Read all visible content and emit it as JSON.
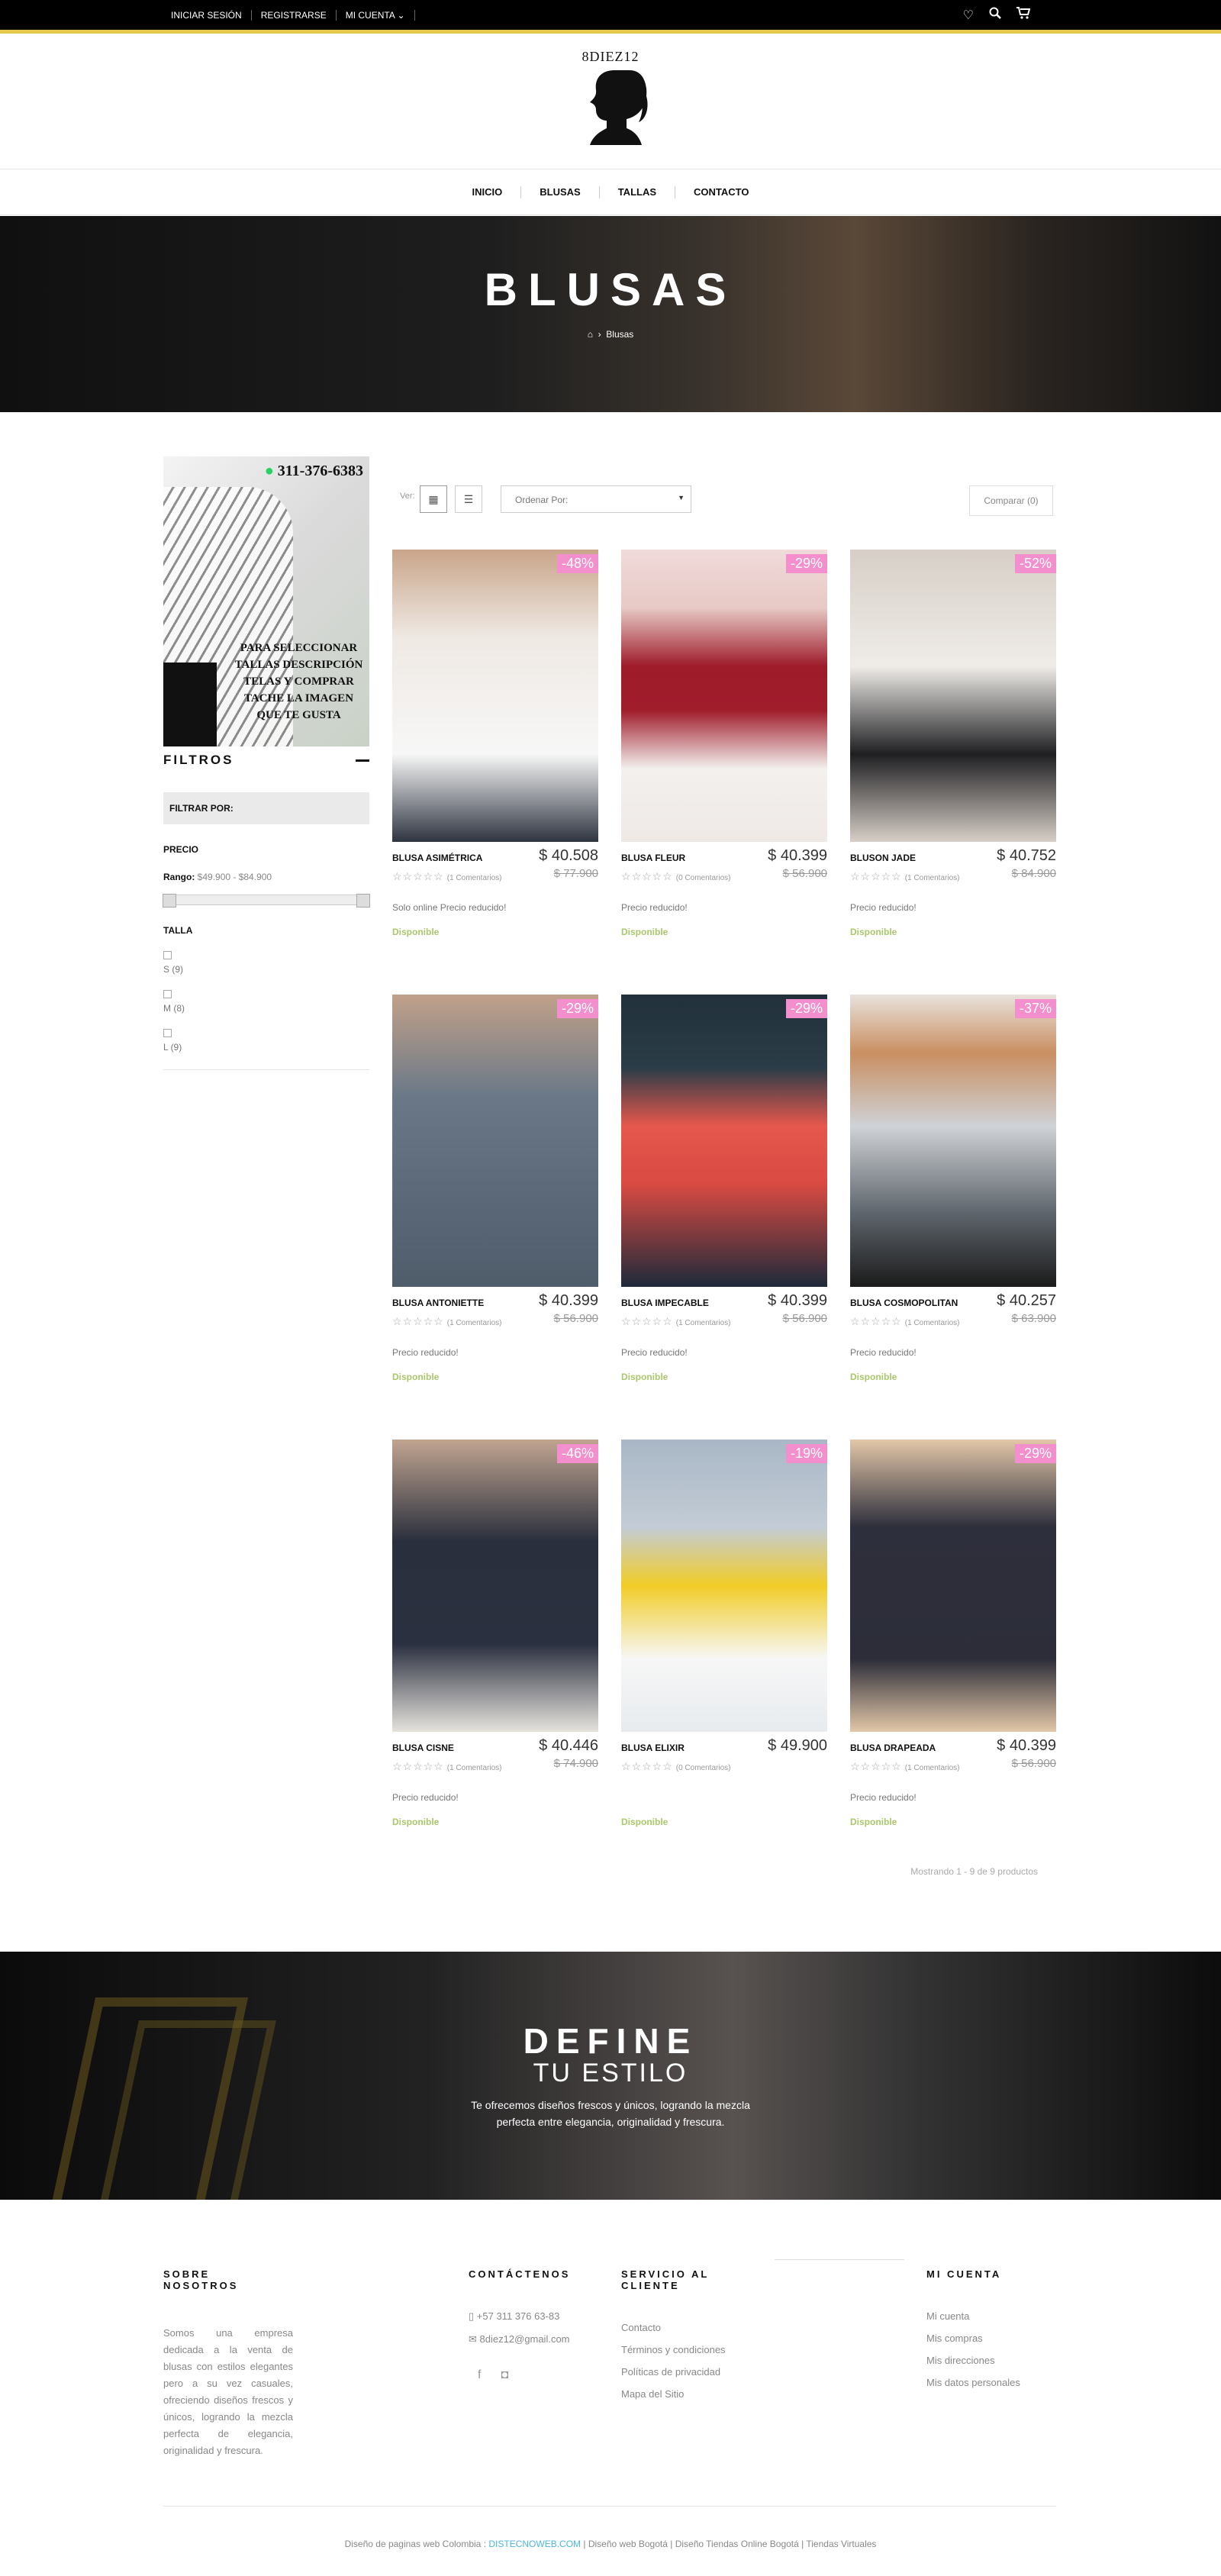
{
  "topbar": {
    "login": "INICIAR SESIÓN",
    "register": "REGISTRARSE",
    "account": "MI CUENTA ⌄",
    "icons": [
      "heart-icon",
      "search-icon",
      "cart-icon"
    ]
  },
  "brand": {
    "name": "8DIEZ12"
  },
  "nav": [
    "INICIO",
    "BLUSAS",
    "TALLAS",
    "CONTACTO"
  ],
  "hero": {
    "title": "BLUSAS",
    "breadcrumb": "Blusas"
  },
  "sidebar": {
    "banner_phone": "311-376-6383",
    "banner_text": "PARA SELECCIONAR TALLAS DESCRIPCIÓN TELAS Y COMPRAR TACHE LA IMAGEN QUE TE GUSTA",
    "filters_title": "FILTROS",
    "filter_by": "FILTRAR POR:",
    "price_label": "PRECIO",
    "range_label": "Rango:",
    "range_value": "$49.900 - $84.900",
    "size_label": "TALLA",
    "sizes": [
      "S (9)",
      "M (8)",
      "L (9)"
    ]
  },
  "toolbar": {
    "view_label": "Ver:",
    "sort_placeholder": "Ordenar Por:",
    "compare_label": "Comparar (0)"
  },
  "products": [
    {
      "name": "BLUSA ASIMÉTRICA",
      "price": "$ 40.508",
      "old": "$ 77.900",
      "badge": "-48%",
      "comments": "(1 Comentarios)",
      "desc": "Solo online Precio reducido!",
      "avail": "Disponible"
    },
    {
      "name": "BLUSA FLEUR",
      "price": "$ 40.399",
      "old": "$ 56.900",
      "badge": "-29%",
      "comments": "(0 Comentarios)",
      "desc": "Precio reducido!",
      "avail": "Disponible"
    },
    {
      "name": "BLUSON JADE",
      "price": "$ 40.752",
      "old": "$ 84.900",
      "badge": "-52%",
      "comments": "(1 Comentarios)",
      "desc": "Precio reducido!",
      "avail": "Disponible"
    },
    {
      "name": "BLUSA ANTONIETTE",
      "price": "$ 40.399",
      "old": "$ 56.900",
      "badge": "-29%",
      "comments": "(1 Comentarios)",
      "desc": "Precio reducido!",
      "avail": "Disponible"
    },
    {
      "name": "BLUSA IMPECABLE",
      "price": "$ 40.399",
      "old": "$ 56.900",
      "badge": "-29%",
      "comments": "(1 Comentarios)",
      "desc": "Precio reducido!",
      "avail": "Disponible"
    },
    {
      "name": "BLUSA COSMOPOLITAN",
      "price": "$ 40.257",
      "old": "$ 63.900",
      "badge": "-37%",
      "comments": "(1 Comentarios)",
      "desc": "Precio reducido!",
      "avail": "Disponible"
    },
    {
      "name": "BLUSA CISNE",
      "price": "$ 40.446",
      "old": "$ 74.900",
      "badge": "-46%",
      "comments": "(1 Comentarios)",
      "desc": "Precio reducido!",
      "avail": "Disponible"
    },
    {
      "name": "BLUSA ELIXIR",
      "price": "$ 49.900",
      "old": "",
      "badge": "-19%",
      "comments": "(0 Comentarios)",
      "desc": "",
      "avail": "Disponible"
    },
    {
      "name": "BLUSA DRAPEADA",
      "price": "$ 40.399",
      "old": "$ 56.900",
      "badge": "-29%",
      "comments": "(1 Comentarios)",
      "desc": "Precio reducido!",
      "avail": "Disponible"
    }
  ],
  "showing": "Mostrando 1 - 9 de 9 productos",
  "define": {
    "title": "DEFINE",
    "subtitle": "TU ESTILO",
    "text": "Te ofrecemos diseños frescos y únicos, logrando la mezcla perfecta entre elegancia, originalidad y frescura."
  },
  "footer": {
    "about_title": "SOBRE NOSOTROS",
    "about_text": "Somos una empresa dedicada a la venta de blusas con estilos elegantes pero a su vez casuales, ofreciendo diseños frescos y únicos, logrando la mezcla perfecta de elegancia, originalidad y frescura.",
    "contact_title": "CONTÁCTENOS",
    "phone": "+57 311 376 63-83",
    "email": "8diez12@gmail.com",
    "service_title": "SERVICIO AL CLIENTE",
    "service_links": [
      "Contacto",
      "Términos y condiciones",
      "Políticas de privacidad",
      "Mapa del Sitio"
    ],
    "account_title": "MI CUENTA",
    "account_links": [
      "Mi cuenta",
      "Mis compras",
      "Mis direcciones",
      "Mis datos personales"
    ],
    "copy_pre": "Diseño de paginas web Colombia :",
    "copy_link": "DISTECNOWEB.COM",
    "copy_post": "| Diseño web Bogotá | Diseño Tiendas Online Bogotá | Tiendas Virtuales"
  },
  "colors": {
    "accent_bar": "#e6c84a",
    "badge": "#f48fce",
    "available": "#a9c76b",
    "link": "#4cb6e0"
  }
}
